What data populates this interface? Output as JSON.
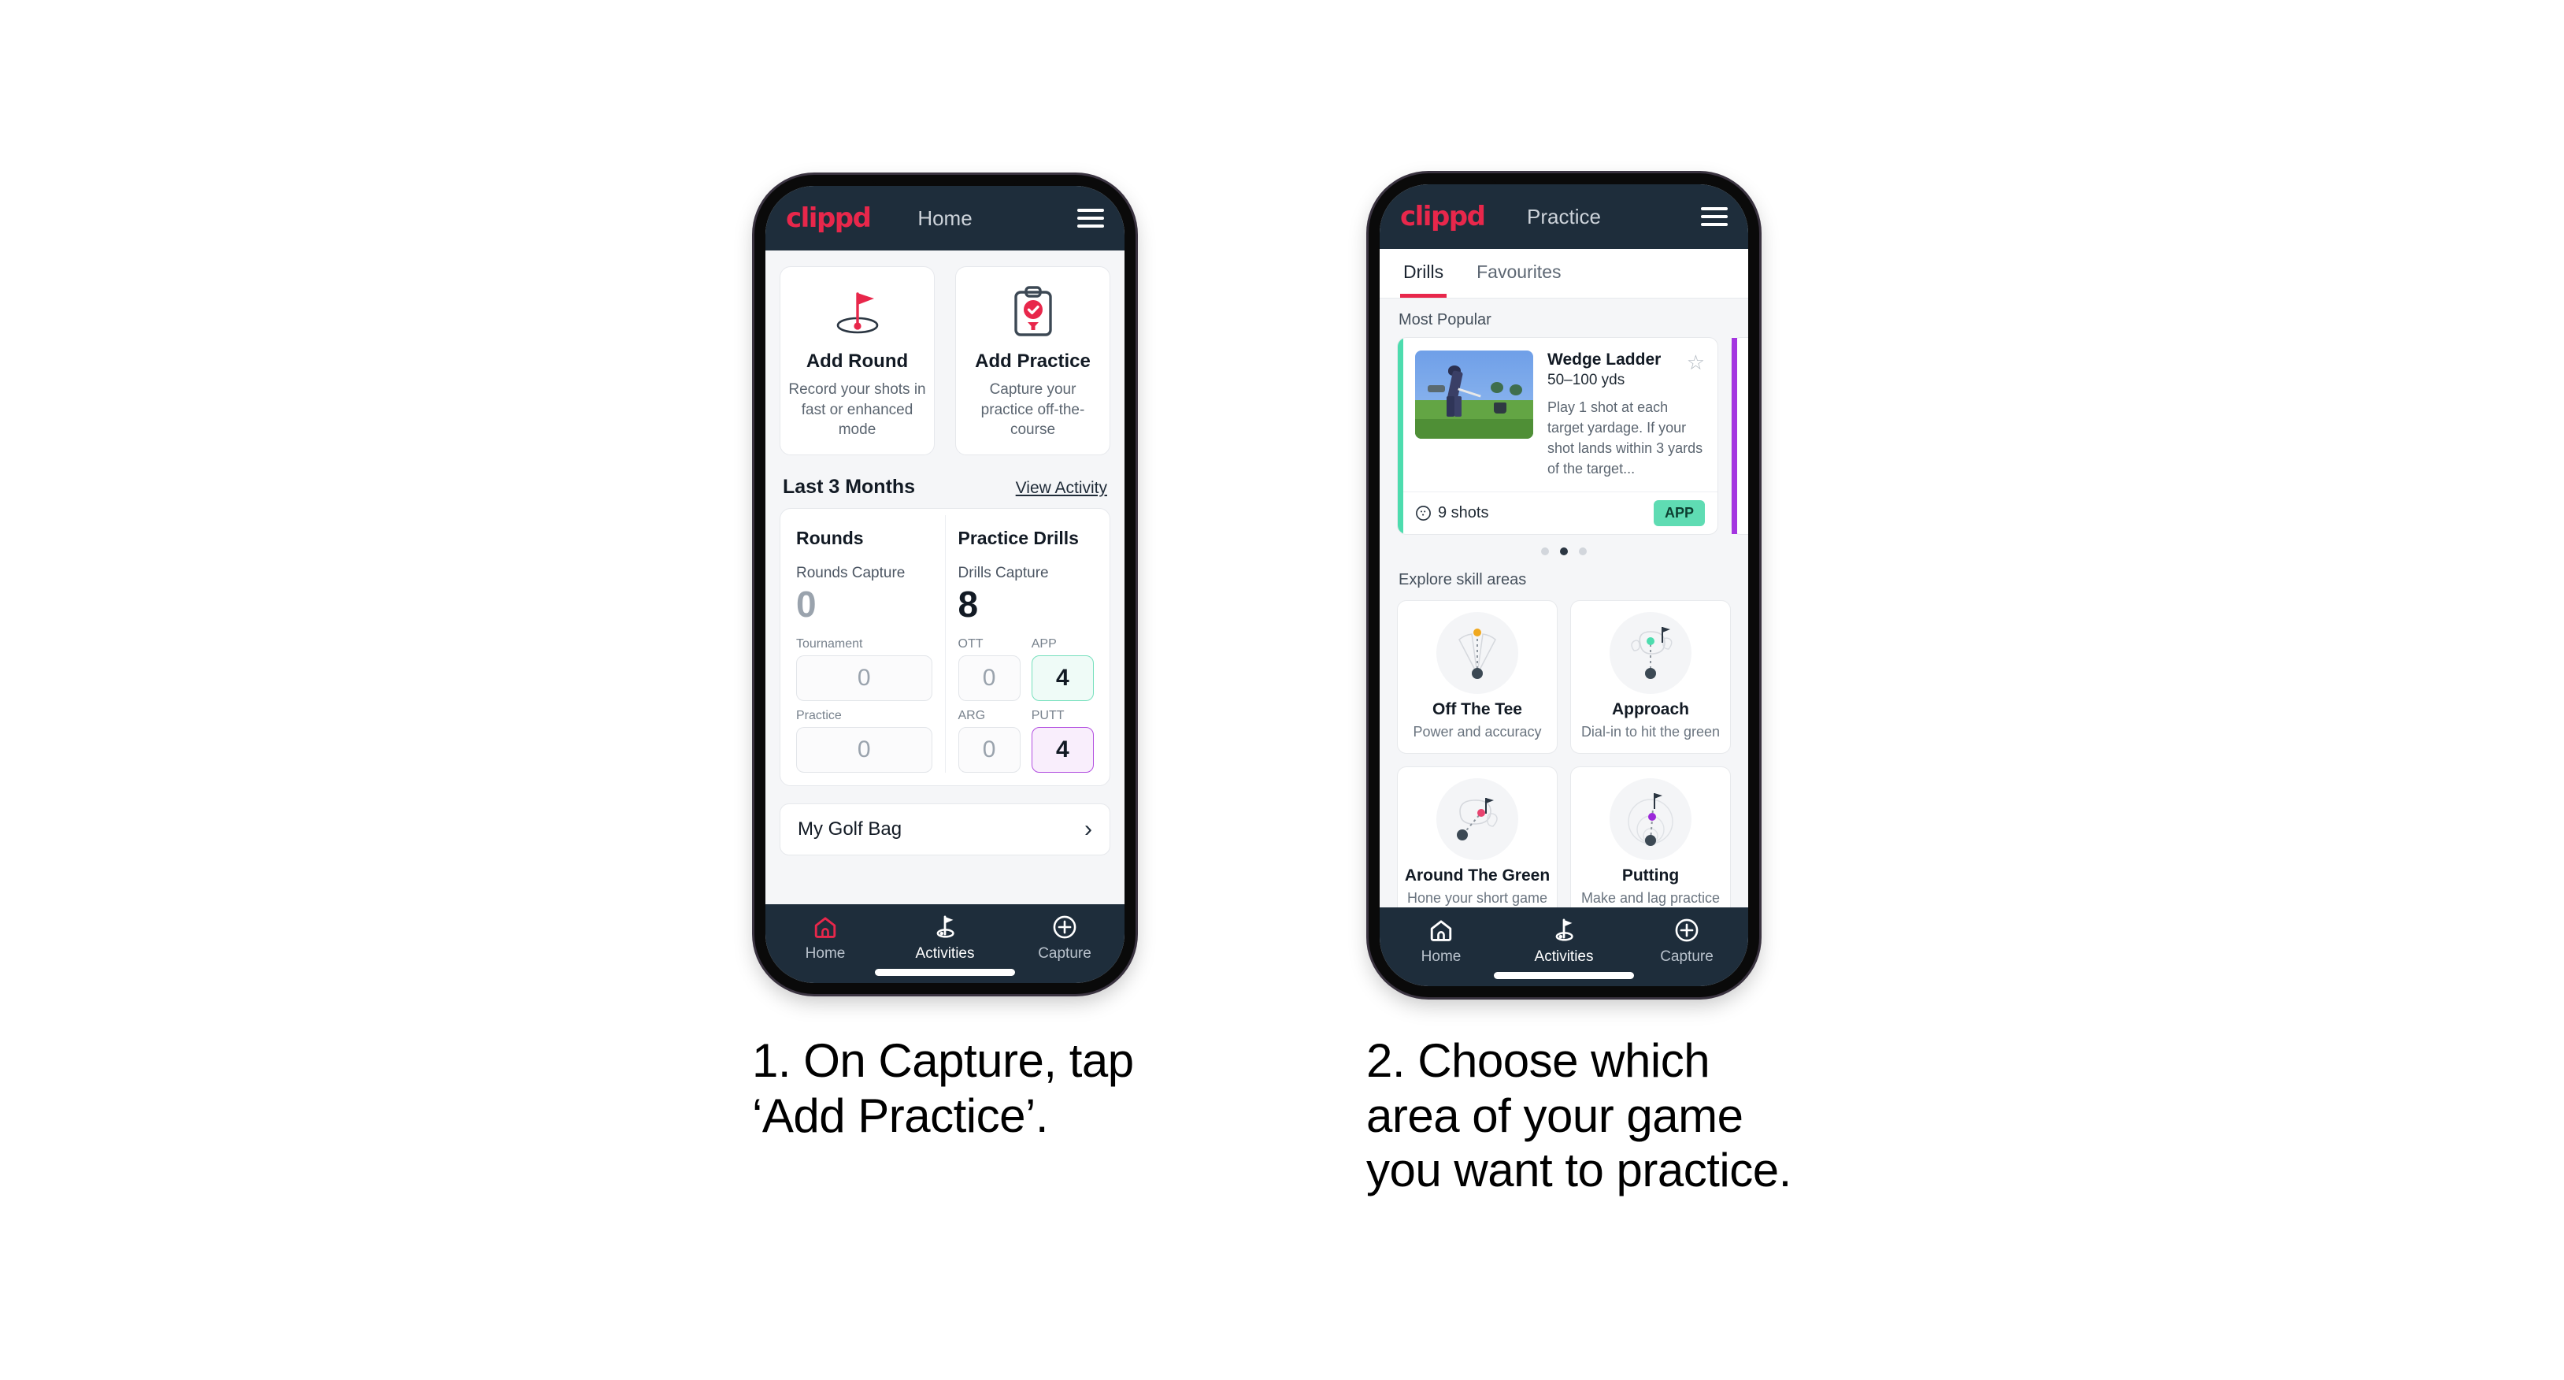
{
  "phones": [
    {
      "id": "home",
      "header": {
        "logo": "clippd",
        "title": "Home",
        "menu_icon": "hamburger-icon"
      },
      "quick_actions": [
        {
          "icon": "golf-flag-hole-icon",
          "title": "Add Round",
          "subtitle": "Record your shots in fast or enhanced mode"
        },
        {
          "icon": "clipboard-check-tee-icon",
          "title": "Add Practice",
          "subtitle": "Capture your practice off-the-course"
        }
      ],
      "section": {
        "title": "Last 3 Months",
        "link": "View Activity"
      },
      "stats": {
        "rounds": {
          "col_title": "Rounds",
          "capture_label": "Rounds Capture",
          "capture_value": "0",
          "metrics": [
            {
              "label": "Tournament",
              "value": "0",
              "highlight": "none"
            },
            {
              "label": "Practice",
              "value": "0",
              "highlight": "none"
            }
          ]
        },
        "drills": {
          "col_title": "Practice Drills",
          "capture_label": "Drills Capture",
          "capture_value": "8",
          "metrics": [
            {
              "label": "OTT",
              "value": "0",
              "highlight": "none"
            },
            {
              "label": "APP",
              "value": "4",
              "highlight": "green"
            },
            {
              "label": "ARG",
              "value": "0",
              "highlight": "none"
            },
            {
              "label": "PUTT",
              "value": "4",
              "highlight": "purple"
            }
          ]
        }
      },
      "golf_bag": {
        "label": "My Golf Bag",
        "chevron": "chevron-right-icon"
      },
      "bottom_nav": [
        {
          "icon": "home-icon",
          "label": "Home",
          "state": "selected-accent"
        },
        {
          "icon": "golf-flag-icon",
          "label": "Activities",
          "state": "active"
        },
        {
          "icon": "plus-circle-icon",
          "label": "Capture",
          "state": "default"
        }
      ]
    },
    {
      "id": "practice",
      "header": {
        "logo": "clippd",
        "title": "Practice",
        "menu_icon": "hamburger-icon"
      },
      "tabs": [
        {
          "label": "Drills",
          "active": true
        },
        {
          "label": "Favourites",
          "active": false
        }
      ],
      "most_popular_label": "Most Popular",
      "drill": {
        "title": "Wedge Ladder",
        "yardage": "50–100 yds",
        "description": "Play 1 shot at each target yardage. If your shot lands within 3 yards of the target...",
        "shots": "9 shots",
        "shots_icon": "golf-ball-icon",
        "badge": "APP",
        "star_icon": "star-outline-icon",
        "thumbnail": "golfer-wedge-shot-photo",
        "accent_color": "#4ddcae",
        "next_card_accent": "#a435e0"
      },
      "carousel_dots": {
        "count": 3,
        "active_index": 1
      },
      "explore_label": "Explore skill areas",
      "skill_areas": [
        {
          "icon": "off-the-tee-icon",
          "title": "Off The Tee",
          "subtitle": "Power and accuracy",
          "dot_color": "#f0a81e"
        },
        {
          "icon": "approach-icon",
          "title": "Approach",
          "subtitle": "Dial-in to hit the green",
          "dot_color": "#4ddcae"
        },
        {
          "icon": "around-the-green-icon",
          "title": "Around The Green",
          "subtitle": "Hone your short game",
          "dot_color": "#e8436f"
        },
        {
          "icon": "putting-icon",
          "title": "Putting",
          "subtitle": "Make and lag practice",
          "dot_color": "#9b28d9"
        }
      ],
      "bottom_nav": [
        {
          "icon": "home-icon",
          "label": "Home",
          "state": "default"
        },
        {
          "icon": "golf-flag-icon",
          "label": "Activities",
          "state": "active"
        },
        {
          "icon": "plus-circle-icon",
          "label": "Capture",
          "state": "default"
        }
      ]
    }
  ],
  "captions": [
    {
      "line1": "1. On Capture, tap",
      "line2": "‘Add Practice’.",
      "line3": ""
    },
    {
      "line1": "2. Choose which",
      "line2": "area of your game",
      "line3": "you want to practice."
    }
  ],
  "colors": {
    "brand_pink": "#e8274b",
    "header_dark": "#1e2d3b",
    "page_bg": "#f5f6f8",
    "green_accent": "#4ddcae",
    "purple_accent": "#a435e0"
  }
}
